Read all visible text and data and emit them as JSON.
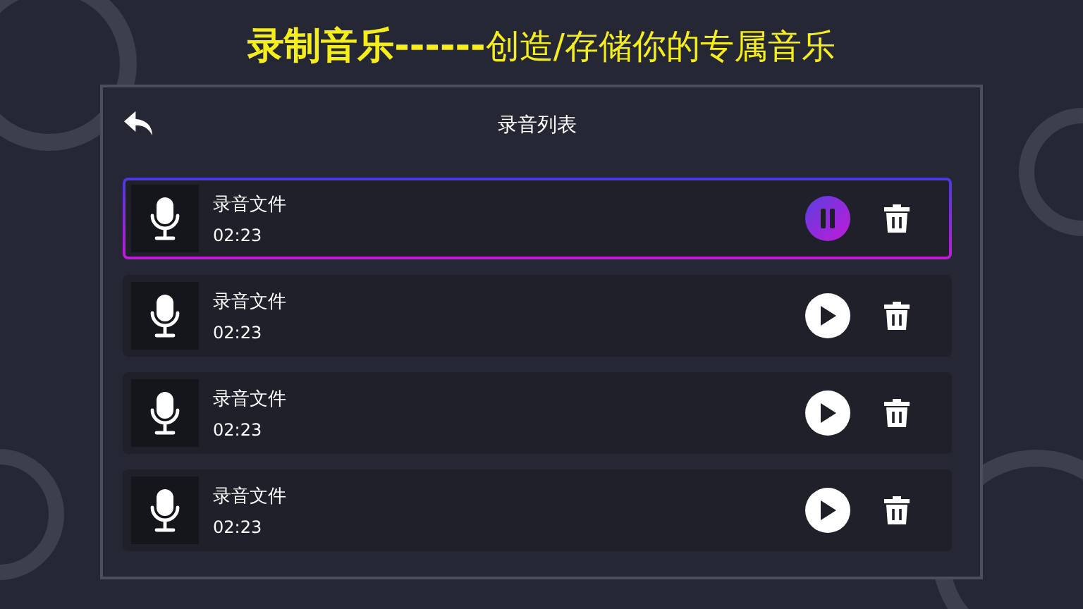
{
  "headline": "**录制音乐------**创造/存储你的专属音乐",
  "panel": {
    "title": "录音列表"
  },
  "recordings": [
    {
      "name": "录音文件",
      "duration": "02:23",
      "playing": true
    },
    {
      "name": "录音文件",
      "duration": "02:23",
      "playing": false
    },
    {
      "name": "录音文件",
      "duration": "02:23",
      "playing": false
    },
    {
      "name": "录音文件",
      "duration": "02:23",
      "playing": false
    }
  ]
}
